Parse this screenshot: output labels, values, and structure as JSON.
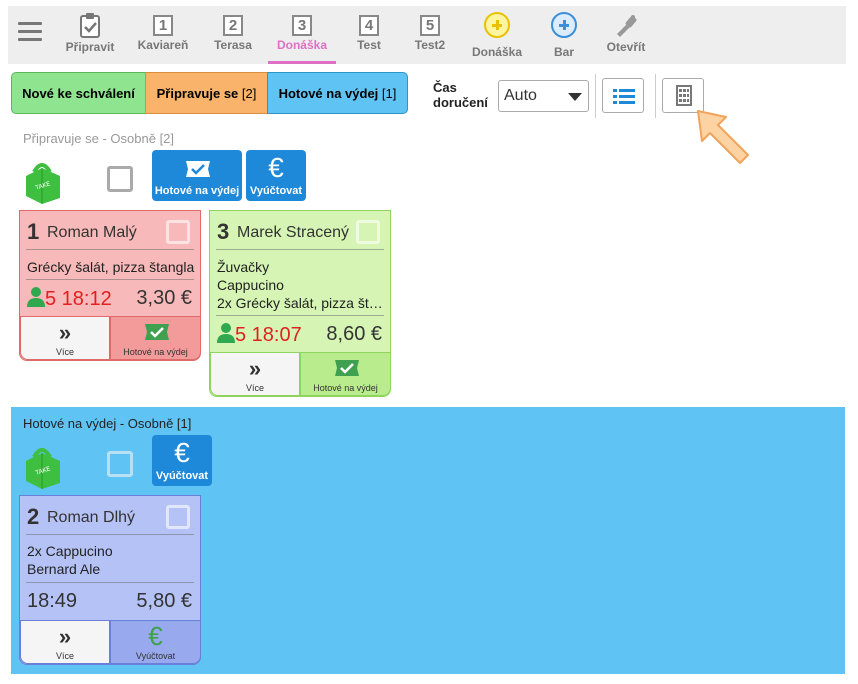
{
  "nav": {
    "items": [
      {
        "label": "Připravit",
        "icon": "clipboard-check-icon"
      },
      {
        "label": "Kaviareň",
        "num": "1"
      },
      {
        "label": "Terasa",
        "num": "2"
      },
      {
        "label": "Donáška",
        "num": "3",
        "active": true
      },
      {
        "label": "Test",
        "num": "4"
      },
      {
        "label": "Test2",
        "num": "5"
      },
      {
        "label": "Donáška",
        "icon": "plus-circle-yellow-icon"
      },
      {
        "label": "Bar",
        "icon": "plus-circle-blue-icon"
      },
      {
        "label": "Otevřít",
        "icon": "bottle-opener-icon"
      }
    ]
  },
  "filters": {
    "new_label": "Nové ke schválení",
    "prep_label": "Připravuje se",
    "prep_count": "[2]",
    "done_label": "Hotové na výdej",
    "done_count": "[1]"
  },
  "delivery": {
    "label_line1": "Čas",
    "label_line2": "doručení",
    "value": "Auto"
  },
  "section_preparing": {
    "title": "Připravuje se - Osobně [2]",
    "ready_button": "Hotové na výdej",
    "bill_button": "Vyúčtovat",
    "orders": [
      {
        "number": "1",
        "name": "Roman Malý",
        "items": [
          "Grécky šalát, pizza štangla"
        ],
        "time": "5 18:12",
        "price": "3,30 €",
        "more_label": "Více",
        "action_label": "Hotové na výdej"
      },
      {
        "number": "3",
        "name": "Marek Stracený",
        "items": [
          "Žuvačky",
          "Cappucino",
          "2x Grécky šalát, pizza št…"
        ],
        "time": "5 18:07",
        "price": "8,60 €",
        "more_label": "Více",
        "action_label": "Hotové na výdej"
      }
    ]
  },
  "section_ready": {
    "title": "Hotové na výdej - Osobně [1]",
    "bill_button": "Vyúčtovat",
    "orders": [
      {
        "number": "2",
        "name": "Roman Dlhý",
        "items": [
          "2x Cappucino",
          "Bernard Ale"
        ],
        "time": "18:49",
        "price": "5,80 €",
        "more_label": "Více",
        "action_label": "Vyúčtovat"
      }
    ]
  },
  "colors": {
    "active": "#e06fc6",
    "new": "#8fe58f",
    "preparing": "#f9b36b",
    "ready": "#5fc3f4",
    "card_red": "#f7b9b9",
    "card_green": "#d6f5b5",
    "card_blue": "#b5c2f5",
    "button_blue": "#1e88d9",
    "time_red": "#e32020"
  }
}
